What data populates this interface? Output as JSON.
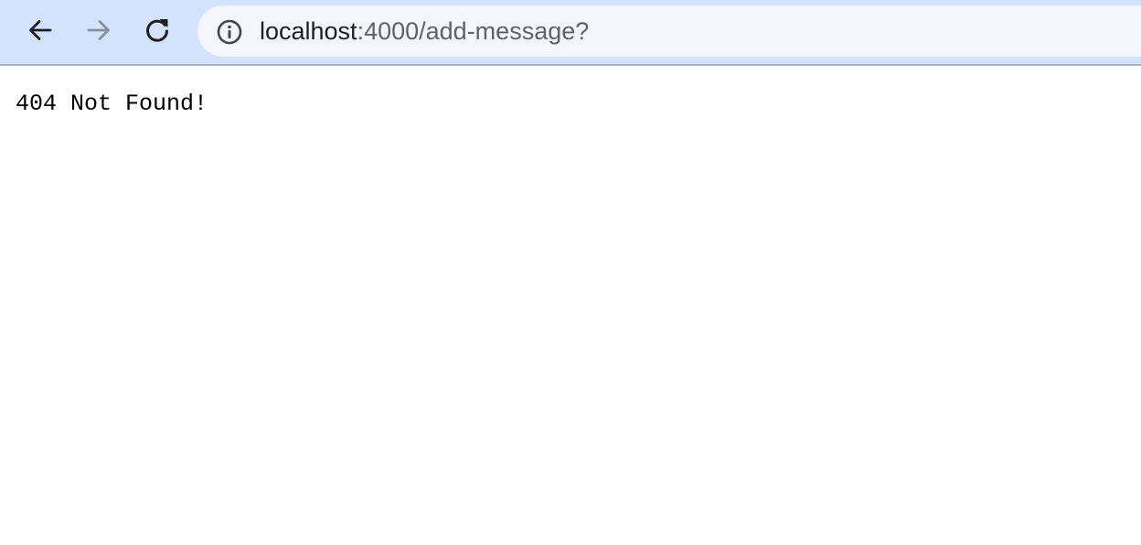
{
  "browser": {
    "back_icon": "arrow-left-icon",
    "forward_icon": "arrow-right-icon",
    "reload_icon": "reload-icon",
    "site_info_icon": "info-circle-icon",
    "url": {
      "host": "localhost",
      "rest": ":4000/add-message?"
    },
    "colors": {
      "toolbar": "#d3e3fd",
      "omnibox": "#f3f6fc"
    }
  },
  "page": {
    "message": "404 Not Found!"
  }
}
